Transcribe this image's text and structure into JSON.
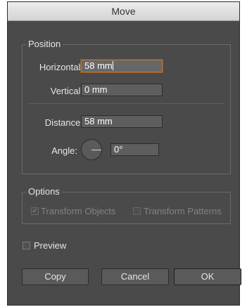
{
  "dialog": {
    "title": "Move"
  },
  "position": {
    "label": "Position",
    "horizontal_label": "Horizontal:",
    "horizontal_value": "58 mm",
    "vertical_label": "Vertical:",
    "vertical_value": "0 mm",
    "distance_label": "Distance:",
    "distance_value": "58 mm",
    "angle_label": "Angle:",
    "angle_value": "0°"
  },
  "options": {
    "label": "Options",
    "transform_objects_label": "Transform Objects",
    "transform_objects_checked": true,
    "transform_patterns_label": "Transform Patterns",
    "transform_patterns_checked": false
  },
  "preview": {
    "label": "Preview",
    "checked": false
  },
  "buttons": {
    "copy": "Copy",
    "cancel": "Cancel",
    "ok": "OK"
  },
  "colors": {
    "window_bg": "#4a4a4a",
    "focus_ring": "#b27a3d"
  },
  "icons": {
    "checkmark": "check-icon",
    "angle_dial": "angle-dial-icon"
  }
}
